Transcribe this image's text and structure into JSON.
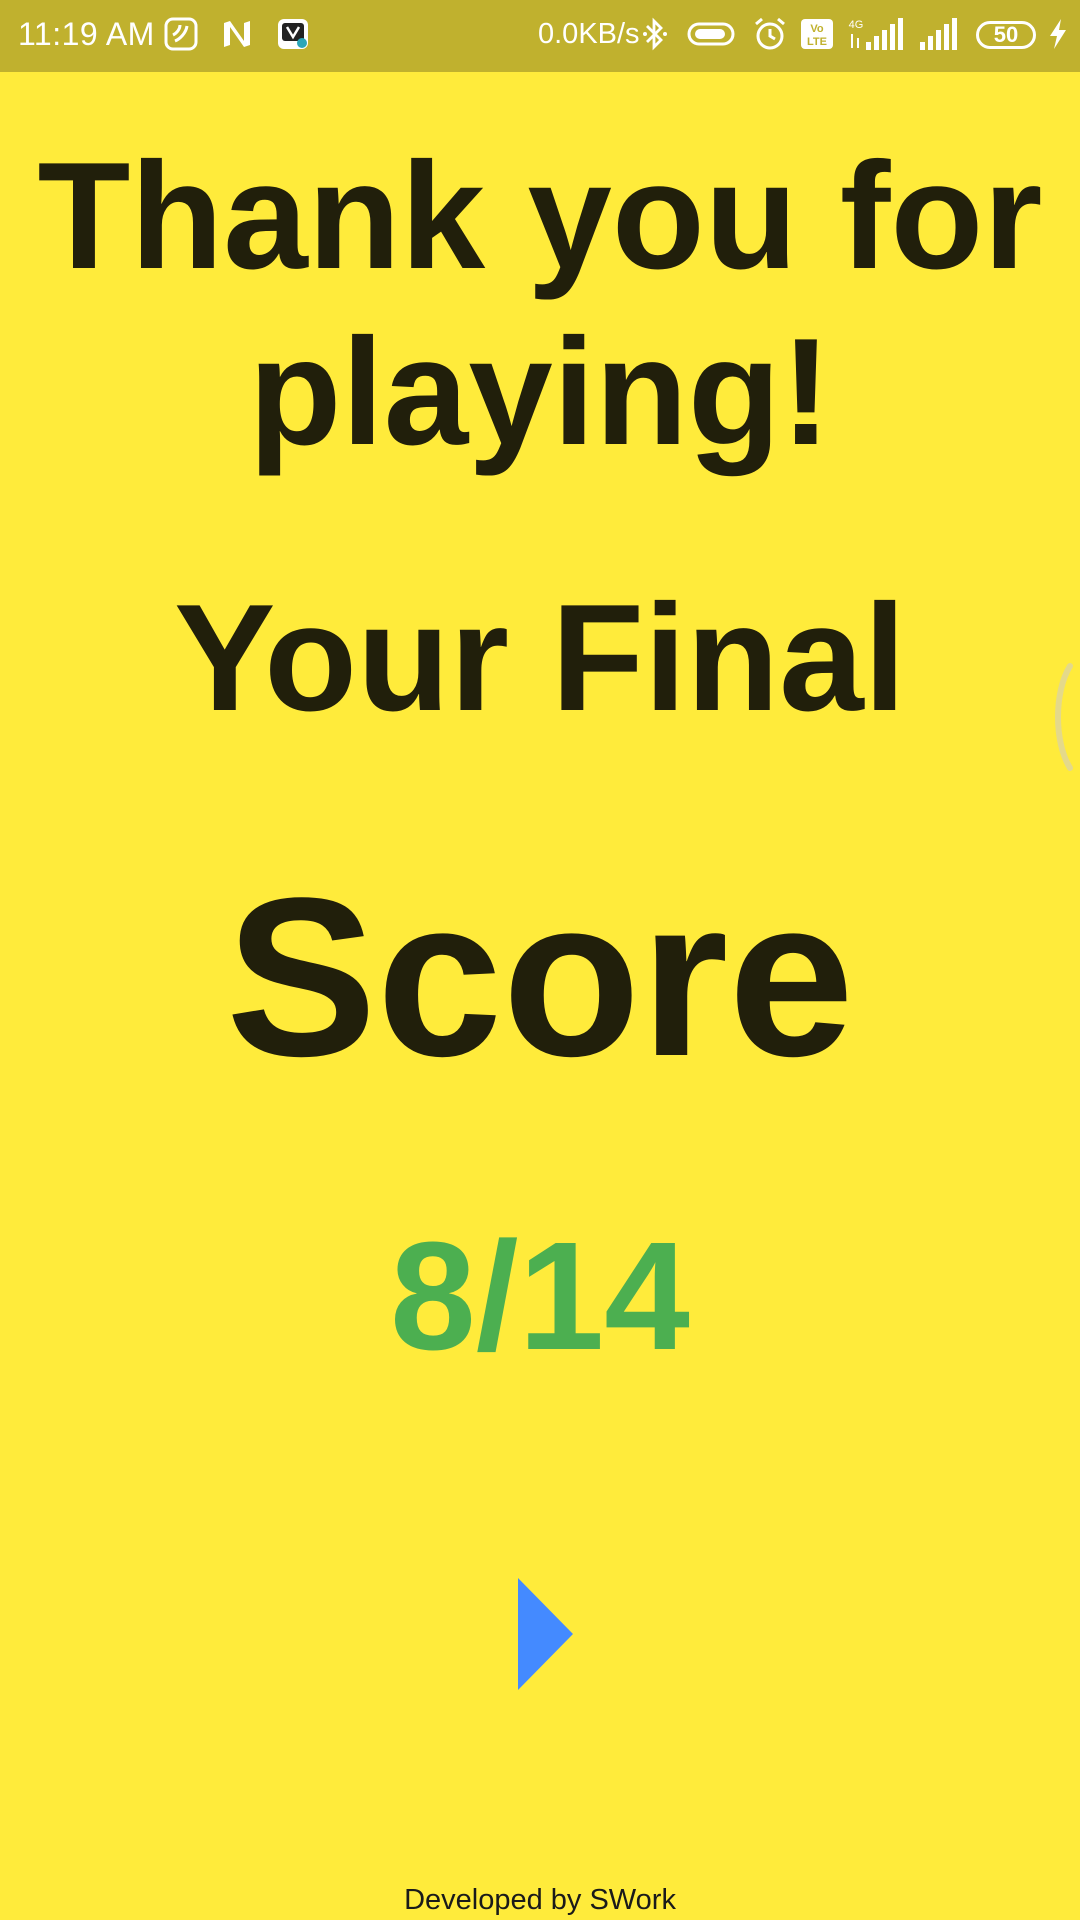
{
  "status_bar": {
    "time": "11:19 AM",
    "network_speed": "0.0KB/s",
    "battery_level": "50",
    "left_icons": [
      "saavn-icon",
      "n-app-icon",
      "media-app-icon"
    ],
    "right_icons": [
      "bluetooth-icon",
      "vibrate-icon",
      "alarm-icon",
      "volte-icon",
      "signal-4g-icon",
      "signal-icon",
      "battery-icon",
      "charging-icon"
    ]
  },
  "main": {
    "thanks_text": "Thank you for playing!",
    "final_text": "Your Final",
    "score_label": "Score",
    "score_value": "8/14",
    "play_icon": "play-icon"
  },
  "footer": {
    "text": "Developed by SWork"
  },
  "colors": {
    "background": "#ffeb3b",
    "status_bar": "#c0b12e",
    "text_dark": "#211f0b",
    "score_green": "#4caf50",
    "play_blue": "#448aff"
  }
}
